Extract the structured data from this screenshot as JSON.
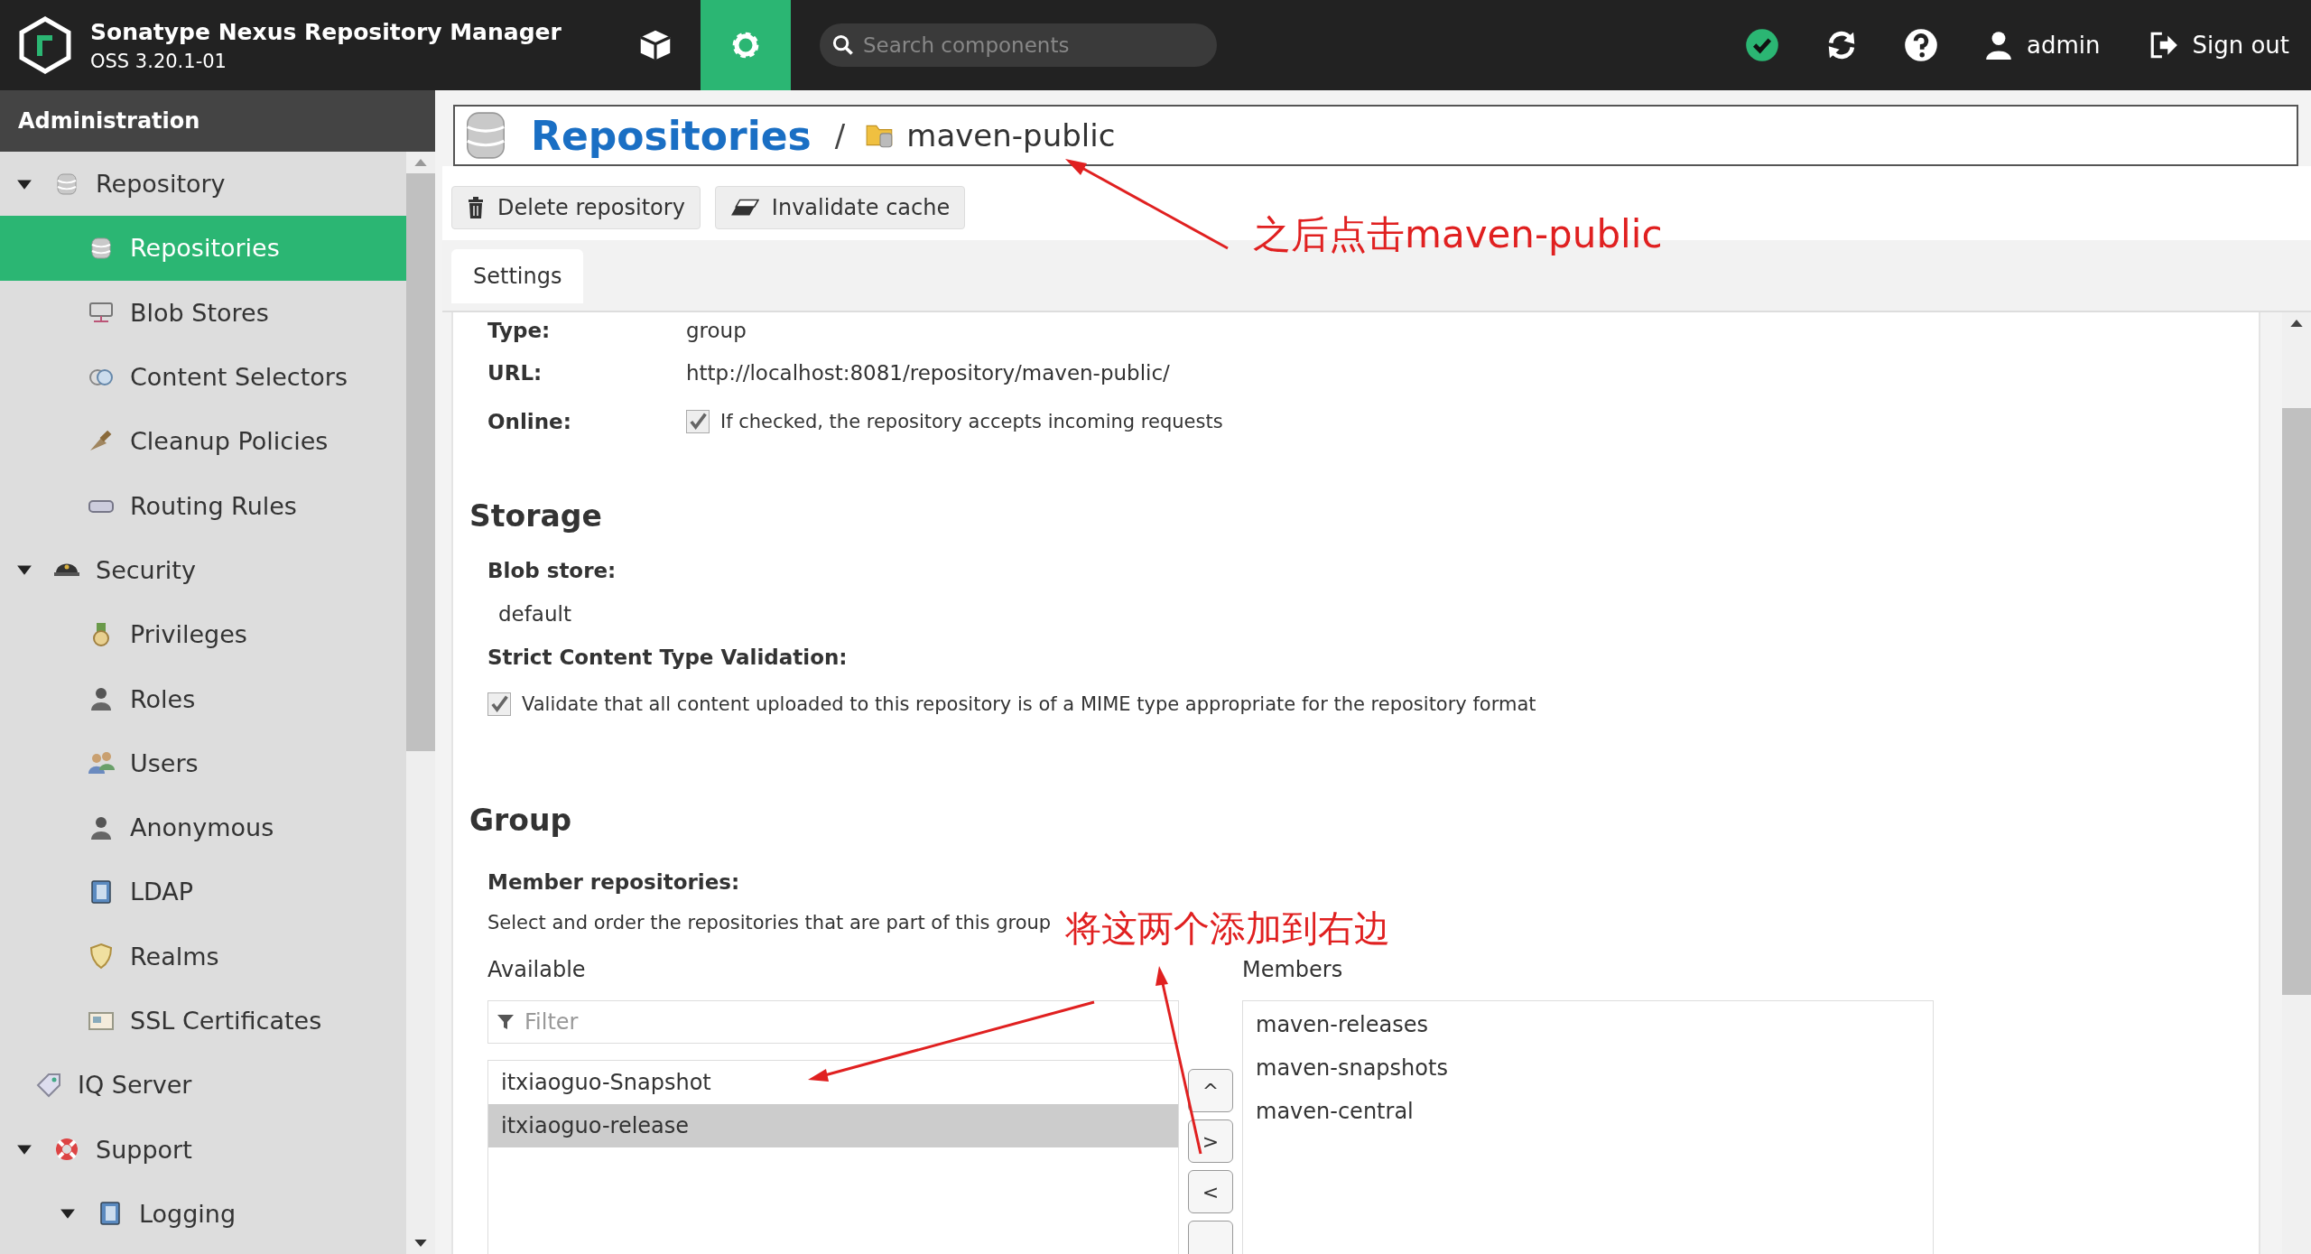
{
  "header": {
    "title": "Sonatype Nexus Repository Manager",
    "version": "OSS 3.20.1-01",
    "modes": [
      {
        "kind": "browse",
        "selected": false
      },
      {
        "kind": "admin",
        "selected": true
      }
    ],
    "search": {
      "placeholder": "Search components"
    },
    "user": "admin",
    "sign_out": "Sign out"
  },
  "sidebar": {
    "title": "Administration",
    "items": [
      {
        "label": "Repository",
        "expanded": true,
        "selected": false,
        "children": [
          {
            "label": "Repositories",
            "selected": true
          },
          {
            "label": "Blob Stores",
            "selected": false
          },
          {
            "label": "Content Selectors",
            "selected": false
          },
          {
            "label": "Cleanup Policies",
            "selected": false
          },
          {
            "label": "Routing Rules",
            "selected": false
          }
        ]
      },
      {
        "label": "Security",
        "expanded": true,
        "selected": false,
        "children": [
          {
            "label": "Privileges",
            "selected": false
          },
          {
            "label": "Roles",
            "selected": false
          },
          {
            "label": "Users",
            "selected": false
          },
          {
            "label": "Anonymous",
            "selected": false
          },
          {
            "label": "LDAP",
            "selected": false
          },
          {
            "label": "Realms",
            "selected": false
          },
          {
            "label": "SSL Certificates",
            "selected": false
          }
        ]
      },
      {
        "label": "IQ Server",
        "selected": false
      },
      {
        "label": "Support",
        "expanded": true,
        "selected": false,
        "children": [
          {
            "label": "Logging",
            "expanded": true,
            "selected": false
          }
        ]
      }
    ]
  },
  "breadcrumb": {
    "title": "Repositories",
    "separator": "/",
    "current": "maven-public"
  },
  "toolbar": [
    "Delete repository",
    "Invalidate cache"
  ],
  "tabs": [
    {
      "label": "Settings",
      "selected": true
    }
  ],
  "form": {
    "rows": [
      {
        "label": "Type:",
        "kind": "text",
        "value": "group"
      },
      {
        "label": "URL:",
        "kind": "text",
        "value": "http://localhost:8081/repository/maven-public/"
      },
      {
        "label": "Online:",
        "kind": "checkbox",
        "checked": true,
        "value": "If checked, the repository accepts incoming requests"
      }
    ],
    "storage": {
      "heading": "Storage",
      "blob_label": "Blob store:",
      "blob_value": "default",
      "strict_label": "Strict Content Type Validation:",
      "strict_checked": true,
      "strict_text": "Validate that all content uploaded to this repository is of a MIME type appropriate for the repository format"
    },
    "group": {
      "heading": "Group",
      "label": "Member repositories:",
      "help": "Select and order the repositories that are part of this group",
      "available_label": "Available",
      "filter_placeholder": "Filter",
      "available": [
        {
          "name": "itxiaoguo-Snapshot",
          "selected": false
        },
        {
          "name": "itxiaoguo-release",
          "selected": true
        }
      ],
      "move_buttons": [
        "^",
        ">",
        "<"
      ],
      "members_label": "Members",
      "members": [
        "maven-releases",
        "maven-snapshots",
        "maven-central"
      ]
    }
  },
  "annotations": [
    "之后点击maven-public",
    "将这两个添加到右边"
  ]
}
